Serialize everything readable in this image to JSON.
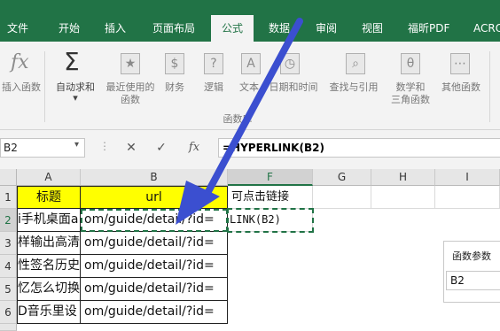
{
  "ribbon_tabs": [
    "文件",
    "开始",
    "插入",
    "页面布局",
    "公式",
    "数据",
    "审阅",
    "视图",
    "福昕PDF",
    "ACRO"
  ],
  "active_tab": "公式",
  "ribbon": {
    "insert_function": "插入函数",
    "insert_function_icon": "fx",
    "autosum": "自动求和",
    "autosum_icon": "Σ",
    "recent": [
      "最近使用的",
      "函数"
    ],
    "finance": "财务",
    "logic": "逻辑",
    "text": "文本",
    "datetime": "日期和时间",
    "lookup": "查找与引用",
    "math": [
      "数学和",
      "三角函数"
    ],
    "other": "其他函数",
    "group_label": "函数库"
  },
  "name_box": "B2",
  "formula_buttons": {
    "cancel": "✕",
    "confirm": "✓",
    "fx": "fx"
  },
  "formula": "=HYPERLINK(B2)",
  "columns": [
    "A",
    "B",
    "F",
    "G",
    "H",
    "I"
  ],
  "rows": [
    "1",
    "2",
    "3",
    "4",
    "5",
    "6"
  ],
  "cells": {
    "A1": "标题",
    "B1": "url",
    "F1": "可点击链接",
    "F2": "LINK(B2)",
    "A": [
      "i手机桌面a",
      "样输出高清",
      "性签名历史",
      "忆怎么切换",
      "D音乐里设"
    ],
    "B": [
      "om/guide/detail/?id=",
      "om/guide/detail/?id=",
      "om/guide/detail/?id=",
      "om/guide/detail/?id=",
      "om/guide/detail/?id="
    ]
  },
  "dialog": {
    "title": "函数参数",
    "field": "B2"
  },
  "colors": {
    "excel_green": "#217346",
    "header_yellow": "#ffff00",
    "arrow_blue": "#3b4fd0"
  }
}
